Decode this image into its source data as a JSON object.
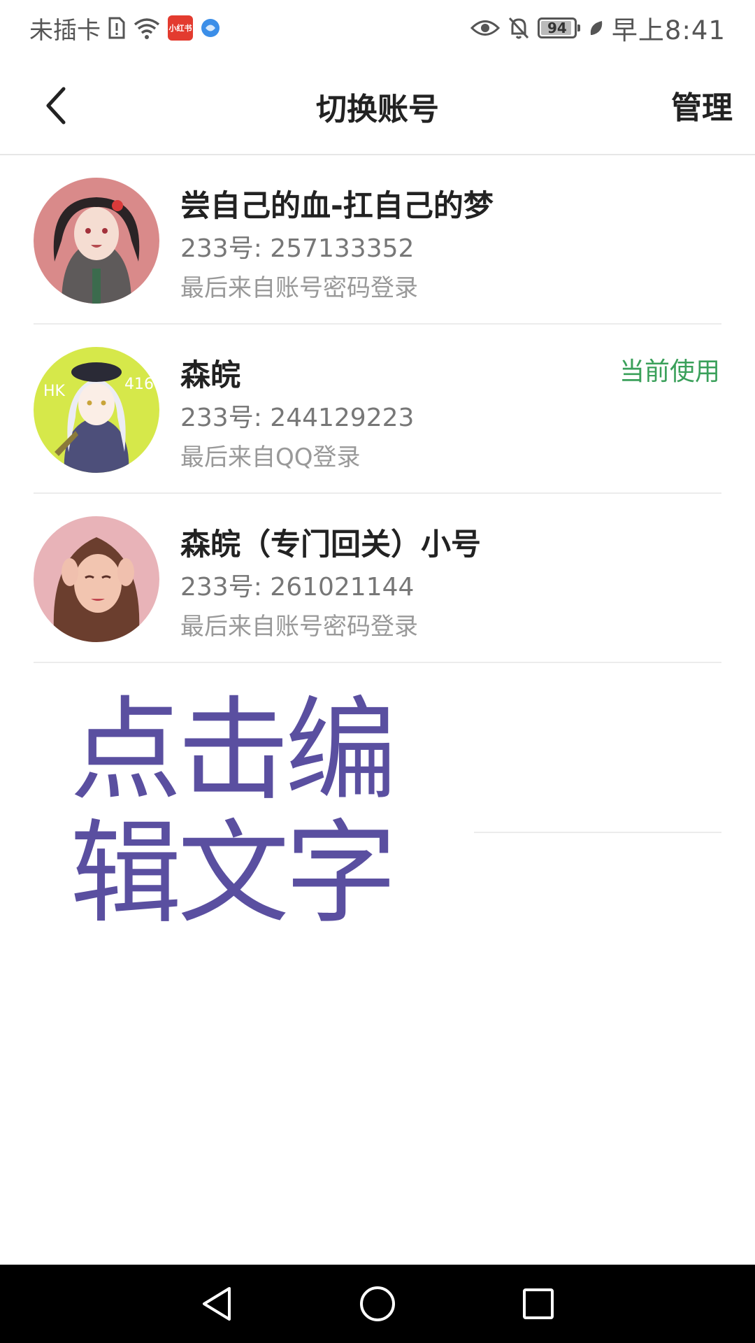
{
  "status_bar": {
    "carrier": "未插卡",
    "battery_level": "94",
    "battery_fraction": 0.94,
    "time": "早上8:41",
    "app_badge": "小红书",
    "icons": [
      "sim-alert-icon",
      "wifi-icon",
      "app-notification-icon",
      "browser-icon",
      "eye-icon",
      "bell-off-icon",
      "battery-icon",
      "leaf-icon"
    ]
  },
  "header": {
    "back_icon": "chevron-left-icon",
    "title": "切换账号",
    "manage_label": "管理"
  },
  "accounts": [
    {
      "name": "尝自己的血-扛自己的梦",
      "id_text": "233号: 257133352",
      "login_text": "最后来自账号密码登录",
      "current": false,
      "avatar_color": "#d98a8a"
    },
    {
      "name": "森皖",
      "id_text": "233号: 244129223",
      "login_text": "最后来自QQ登录",
      "current": true,
      "current_label": "当前使用",
      "avatar_color": "#d6e84a"
    },
    {
      "name": "森皖（专门回关）小号",
      "id_text": "233号: 261021144",
      "login_text": "最后来自账号密码登录",
      "current": false,
      "avatar_color": "#e8b3b8"
    }
  ],
  "overlay": {
    "line1": "点击编",
    "line2": "辑文字",
    "color": "#5a4fa0"
  },
  "colors": {
    "accent_green": "#3aa05a",
    "text_primary": "#222222",
    "text_secondary": "#777777",
    "nav_bar": "#000000"
  },
  "nav_bar": {
    "icons": [
      "back-triangle-icon",
      "home-circle-icon",
      "recents-square-icon"
    ]
  }
}
